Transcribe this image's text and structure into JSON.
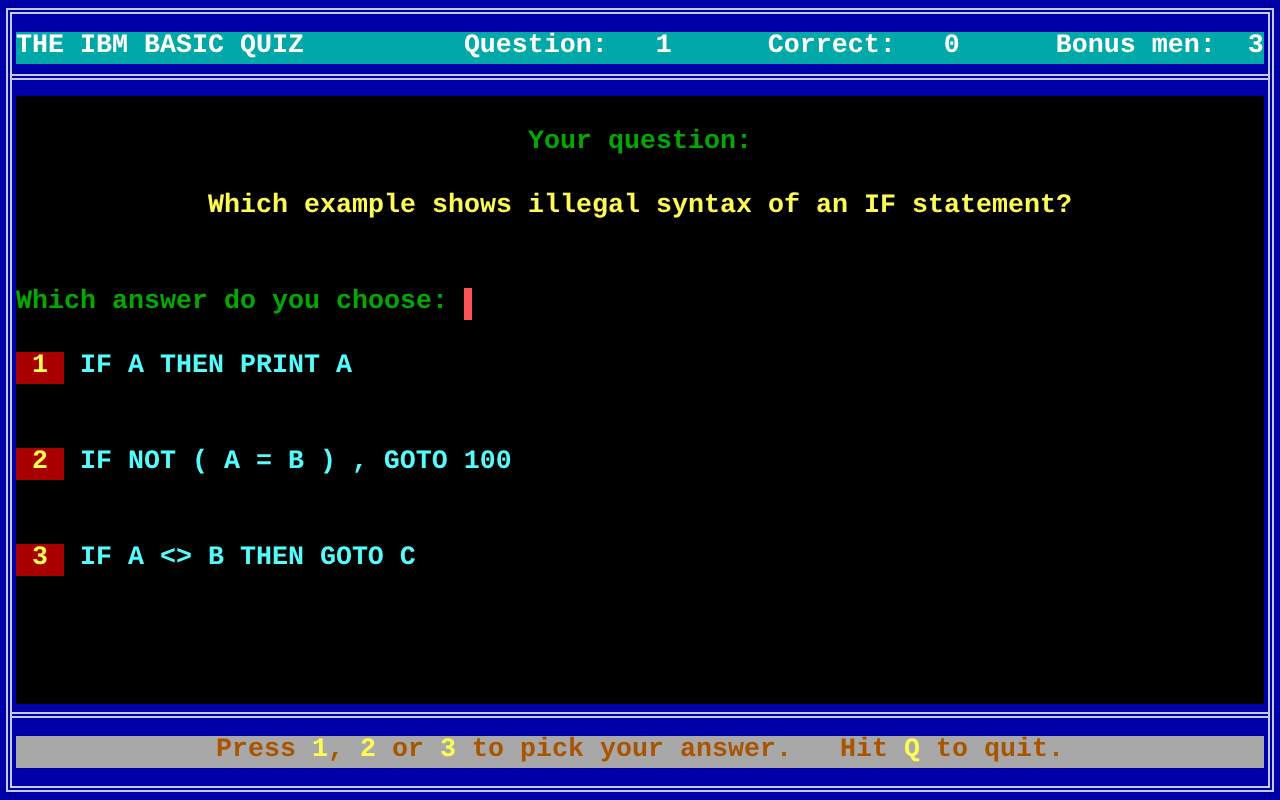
{
  "title_bar": {
    "title": "THE IBM BASIC QUIZ",
    "fields": [
      {
        "label": "Question:",
        "value": "1"
      },
      {
        "label": "Correct:",
        "value": "0"
      },
      {
        "label": "Bonus men:",
        "value": "3"
      }
    ]
  },
  "question": {
    "heading": "Your question:",
    "text": "Which example shows illegal syntax of an IF statement?"
  },
  "prompt": "Which answer do you choose:",
  "answers": [
    {
      "key": "1",
      "text": "IF A THEN PRINT A"
    },
    {
      "key": "2",
      "text": "IF NOT ( A = B ) , GOTO 100"
    },
    {
      "key": "3",
      "text": "IF A <> B THEN GOTO C"
    }
  ],
  "status_bar": {
    "segments": [
      {
        "text": "Press ",
        "highlight": false
      },
      {
        "text": "1",
        "highlight": true
      },
      {
        "text": ", ",
        "highlight": false
      },
      {
        "text": "2",
        "highlight": true
      },
      {
        "text": " or ",
        "highlight": false
      },
      {
        "text": "3",
        "highlight": true
      },
      {
        "text": " to pick your answer.   Hit ",
        "highlight": false
      },
      {
        "text": "Q",
        "highlight": true
      },
      {
        "text": " to quit.",
        "highlight": false
      }
    ]
  }
}
